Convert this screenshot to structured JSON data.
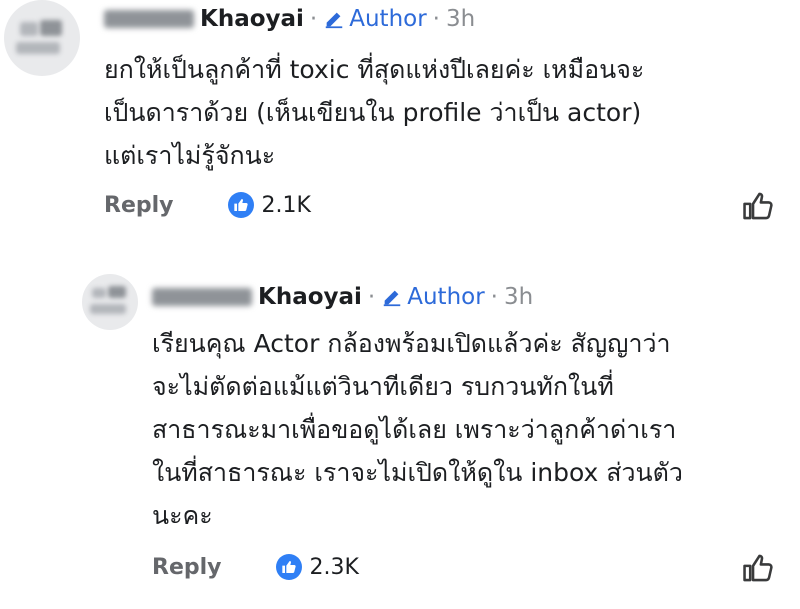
{
  "comment1": {
    "username": "Khaoyai",
    "author_label": "Author",
    "separator": "·",
    "time": "3h",
    "text_lines": [
      "ยกให้เป็นลูกค้าที่ toxic ที่สุดแห่งปีเลยค่ะ เหมือนจะ",
      "เป็นดาราด้วย (เห็นเขียนใน profile ว่าเป็น actor)",
      "แต่เราไม่รู้จักนะ"
    ],
    "reply_label": "Reply",
    "reaction_count": "2.1K"
  },
  "comment2": {
    "username": "Khaoyai",
    "author_label": "Author",
    "separator": "·",
    "time": "3h",
    "text_lines": [
      "เรียนคุณ Actor กล้องพร้อมเปิดแล้วค่ะ สัญญาว่า",
      "จะไม่ตัดต่อแม้แต่วินาทีเดียว รบกวนทักในที่",
      "สาธารณะมาเพื่อขอดูได้เลย เพราะว่าลูกค้าด่าเรา",
      "ในที่สาธารณะ เราจะไม่เปิดให้ดูใน inbox ส่วนตัว",
      "นะคะ"
    ],
    "reply_label": "Reply",
    "reaction_count": "2.3K"
  },
  "colors": {
    "author_blue": "#2d6ad9",
    "like_blue": "#2f7ff5",
    "muted_gray": "#65676b"
  },
  "icons": [
    "pencil-icon",
    "like-reaction-icon",
    "thumbs-up-outline-icon"
  ]
}
